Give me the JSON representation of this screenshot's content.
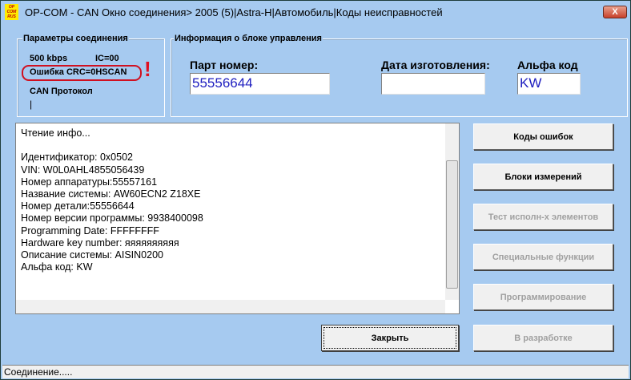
{
  "window": {
    "title": "OP-COM - CAN Окно соединения> 2005 (5)|Astra-H|Автомобиль|Коды неисправностей",
    "logo": "OP COM RUS",
    "close": "X"
  },
  "connection": {
    "legend": "Параметры соединения",
    "speed": "500 kbps",
    "ic": "IC=00",
    "crc_error": "Ошибка CRC=0HSCAN",
    "alert": "!",
    "protocol_label": "CAN Протокол",
    "protocol_value": "|"
  },
  "ecu": {
    "legend": "Информация о блоке управления",
    "part_label": "Парт номер:",
    "part_value": "55556644",
    "date_label": "Дата изготовления:",
    "date_value": "",
    "alpha_label": "Альфа код",
    "alpha_value": "KW"
  },
  "log": [
    "Чтение инфо...",
    "",
    "Идентификатор: 0x0502",
    "VIN: W0L0AHL4855056439",
    "Номер аппаратуры:55557161",
    "Название системы: AW60ECN2 Z18XE",
    "Номер детали:55556644",
    "Номер версии программы: 9938400098",
    "Programming Date: FFFFFFFF",
    "Hardware key number: яяяяяяяяяя",
    "Описание системы: AISIN0200",
    "Альфа код: KW"
  ],
  "buttons": {
    "codes": "Коды ошибок",
    "blocks": "Блоки измерений",
    "test": "Тест исполн-х элементов",
    "special": "Специальные функции",
    "programming": "Программирование",
    "dev": "В разработке",
    "close": "Закрыть"
  },
  "status": "Соединение....."
}
